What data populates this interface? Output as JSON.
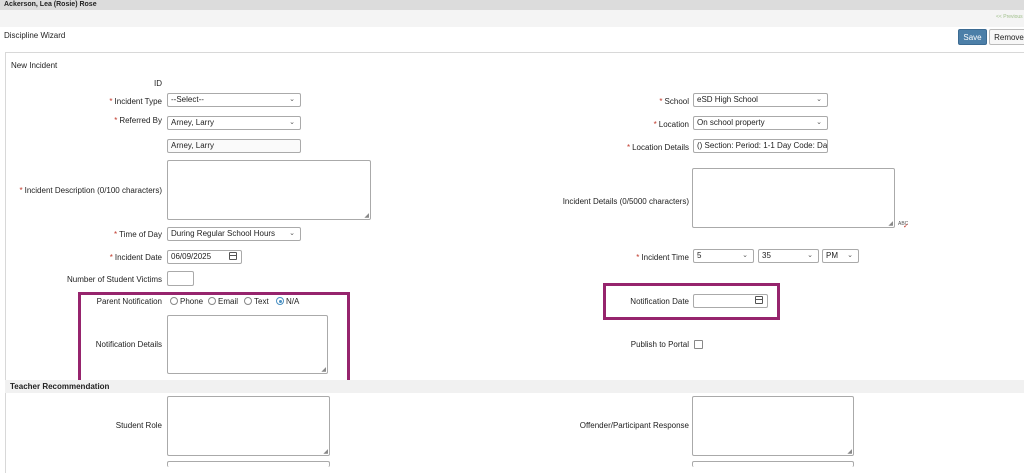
{
  "student": {
    "name": "Ackerson, Lea (Rosie) Rose"
  },
  "header": {
    "previous_link": "<< Previous"
  },
  "wizard": {
    "title": "Discipline Wizard",
    "save_label": "Save",
    "remove_label": "Remove"
  },
  "section": {
    "new_incident": "New Incident",
    "teacher_recommendation": "Teacher Recommendation"
  },
  "fields": {
    "id": {
      "label": "ID",
      "value": ""
    },
    "incident_type": {
      "label": "Incident Type",
      "value": "--Select--",
      "required": true
    },
    "referred_by": {
      "label": "Referred By",
      "value": "Arney, Larry",
      "required": true
    },
    "referred_by_display": {
      "value": "Arney, Larry"
    },
    "incident_description": {
      "label": "Incident Description (0/100 characters)",
      "value": "",
      "required": true
    },
    "time_of_day": {
      "label": "Time of Day",
      "value": "During Regular School Hours",
      "required": true
    },
    "incident_date": {
      "label": "Incident Date",
      "value": "06/09/2025",
      "required": true
    },
    "student_victims": {
      "label": "Number of Student Victims",
      "value": ""
    },
    "parent_notification": {
      "label": "Parent Notification",
      "options": [
        "Phone",
        "Email",
        "Text",
        "N/A"
      ],
      "selected": "N/A"
    },
    "notification_details": {
      "label": "Notification Details",
      "value": ""
    },
    "school": {
      "label": "School",
      "value": "eSD High School",
      "required": true
    },
    "location": {
      "label": "Location",
      "value": "On school property",
      "required": true
    },
    "location_details": {
      "label": "Location Details",
      "value": "() Section:  Period: 1-1 Day Code: Da",
      "required": true
    },
    "incident_details": {
      "label": "Incident Details (0/5000 characters)",
      "value": ""
    },
    "incident_time": {
      "label": "Incident Time",
      "hour": "5",
      "minute": "35",
      "ampm": "PM",
      "required": true
    },
    "notification_date": {
      "label": "Notification Date",
      "value": ""
    },
    "publish_to_portal": {
      "label": "Publish to Portal",
      "checked": false
    },
    "student_role": {
      "label": "Student Role",
      "value": ""
    },
    "offender_response": {
      "label": "Offender/Participant Response",
      "value": ""
    }
  },
  "spellcheck": {
    "label": "ABC"
  },
  "colors": {
    "save_button": "#4c7fa8",
    "highlight_box": "#96246d",
    "required_star": "#c0392b",
    "radio_selected": "#4a90c2"
  }
}
